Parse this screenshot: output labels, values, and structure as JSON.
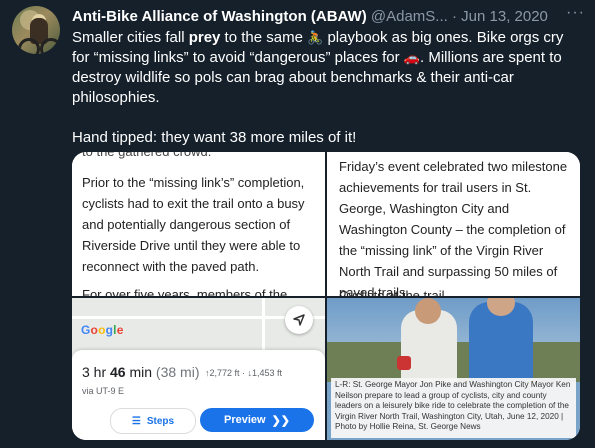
{
  "author": {
    "name": "Anti-Bike Alliance of Washington (ABAW)",
    "handle": "@AdamS...",
    "separator": "·",
    "date": "Jun 13, 2020"
  },
  "more_icon": "more-horizontal-icon",
  "tweet": {
    "line1_a": "Smaller cities fall ",
    "line1_bold": "prey",
    "line1_b": " to the same ",
    "emoji_bike": "🚴",
    "line1_c": " playbook as big ones. Bike orgs cry for “missing links” to avoid “dangerous” places for ",
    "emoji_car": "🚗",
    "line1_d": ". Millions are spent to destroy wildlife so pols can brag about benchmarks & their anti-car philosophies.",
    "line2": "Hand tipped: they want 38 more miles of it!"
  },
  "media": {
    "article_left": {
      "cut_top": "to the gathered crowd.",
      "paragraph": "Prior to the “missing link’s” completion, cyclists had to exit the trail onto a busy and potentially dangerous section of Riverside Drive until they were able to reconnect with the paved path.",
      "cut_bottom": "For over five years, members of the"
    },
    "article_right": {
      "paragraph": "Friday’s event celebrated two milestone achievements for trail users in St. George, Washington City and Washington County – the completion of the “missing link” of the Virgin River North Trail and surpassing 50 miles of paved trails.",
      "cut_bottom": "Cyclists at the trail..."
    },
    "map": {
      "logo": "Google",
      "logo_colors": [
        "#4285F4",
        "#EA4335",
        "#FBBC05",
        "#4285F4",
        "#34A853",
        "#EA4335"
      ],
      "time_hr": "3 hr ",
      "time_min": "46",
      "time_unit": " min",
      "time_alt": " (38 mi)",
      "elevation": "↑2,772 ft · ↓1,453 ft",
      "via": "via UT-9 E",
      "steps_label": "Steps",
      "preview_label": "Preview",
      "accent": "#1a73e8"
    },
    "photo": {
      "caption": "L-R: St. George Mayor Jon Pike and Washington City Mayor Ken Neilson prepare to lead a group of cyclists, city and county leaders on a leisurely bike ride to celebrate the completion of the Virgin River North Trail, Washington City, Utah, June 12, 2020 | Photo by Hollie Reina, St. George News"
    }
  }
}
